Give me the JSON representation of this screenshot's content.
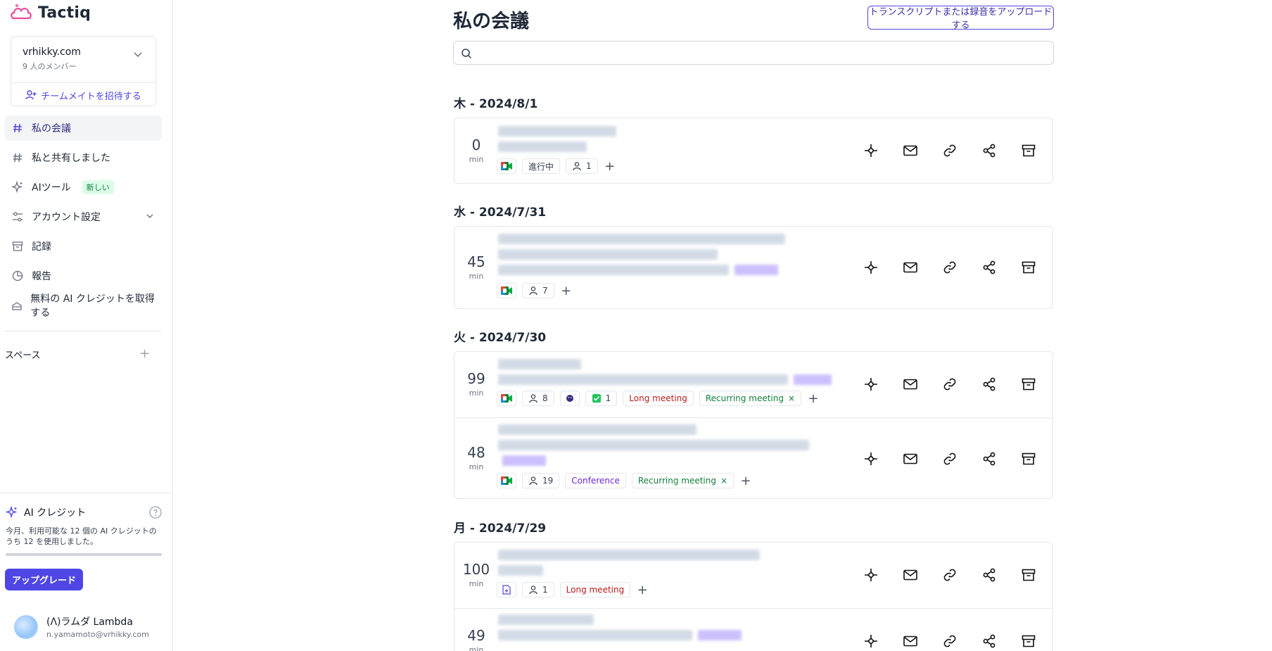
{
  "app": {
    "name": "Tactiq"
  },
  "workspace": {
    "name": "vrhikky.com",
    "members": "9 人のメンバー",
    "invite_label": "チームメイトを招待する"
  },
  "nav": [
    {
      "label": "私の会議",
      "icon": "hash-icon",
      "active": true
    },
    {
      "label": "私と共有しました",
      "icon": "hash-icon"
    },
    {
      "label": "AIツール",
      "icon": "sparkle-icon",
      "badge": "新しい"
    },
    {
      "label": "アカウント設定",
      "icon": "sliders-icon"
    },
    {
      "label": "記録",
      "icon": "archive-icon"
    },
    {
      "label": "報告",
      "icon": "pie-chart-icon"
    },
    {
      "label": "無料の AI クレジットを取得する",
      "icon": "gift-icon"
    }
  ],
  "spaces": {
    "label": "スペース"
  },
  "credits": {
    "title": "AI クレジット",
    "desc": "今月、利用可能な 12 個の AI クレジットのうち 12 を使用しました。",
    "used_fraction": 1.0,
    "upgrade_label": "アップグレード"
  },
  "user": {
    "name": "(Λ)ラムダ Lambda",
    "email": "n.yamamoto@vrhikky.com"
  },
  "main": {
    "title": "私の会議",
    "upload_label": "トランスクリプトまたは録音をアップロードする",
    "search_placeholder": "",
    "days": [
      {
        "label": "木 - 2024/8/1",
        "meetings": [
          {
            "duration": "0",
            "unit": "min",
            "status": "進行中",
            "participants": "1"
          }
        ]
      },
      {
        "label": "水 - 2024/7/31",
        "meetings": [
          {
            "duration": "45",
            "unit": "min",
            "participants": "7"
          }
        ]
      },
      {
        "label": "火 - 2024/7/30",
        "meetings": [
          {
            "duration": "99",
            "unit": "min",
            "participants": "8",
            "tasks": "1",
            "tags": [
              "Long meeting",
              "Recurring meeting"
            ]
          },
          {
            "duration": "48",
            "unit": "min",
            "participants": "19",
            "tags": [
              "Conference",
              "Recurring meeting"
            ]
          }
        ]
      },
      {
        "label": "月 - 2024/7/29",
        "meetings": [
          {
            "duration": "100",
            "unit": "min",
            "participants": "1",
            "tags": [
              "Long meeting"
            ]
          },
          {
            "duration": "49",
            "unit": "min"
          }
        ]
      }
    ]
  },
  "colors": {
    "accent": "#4f46e5",
    "long": "#b91c1c",
    "recurring": "#15803d",
    "conference": "#6d28d9"
  }
}
